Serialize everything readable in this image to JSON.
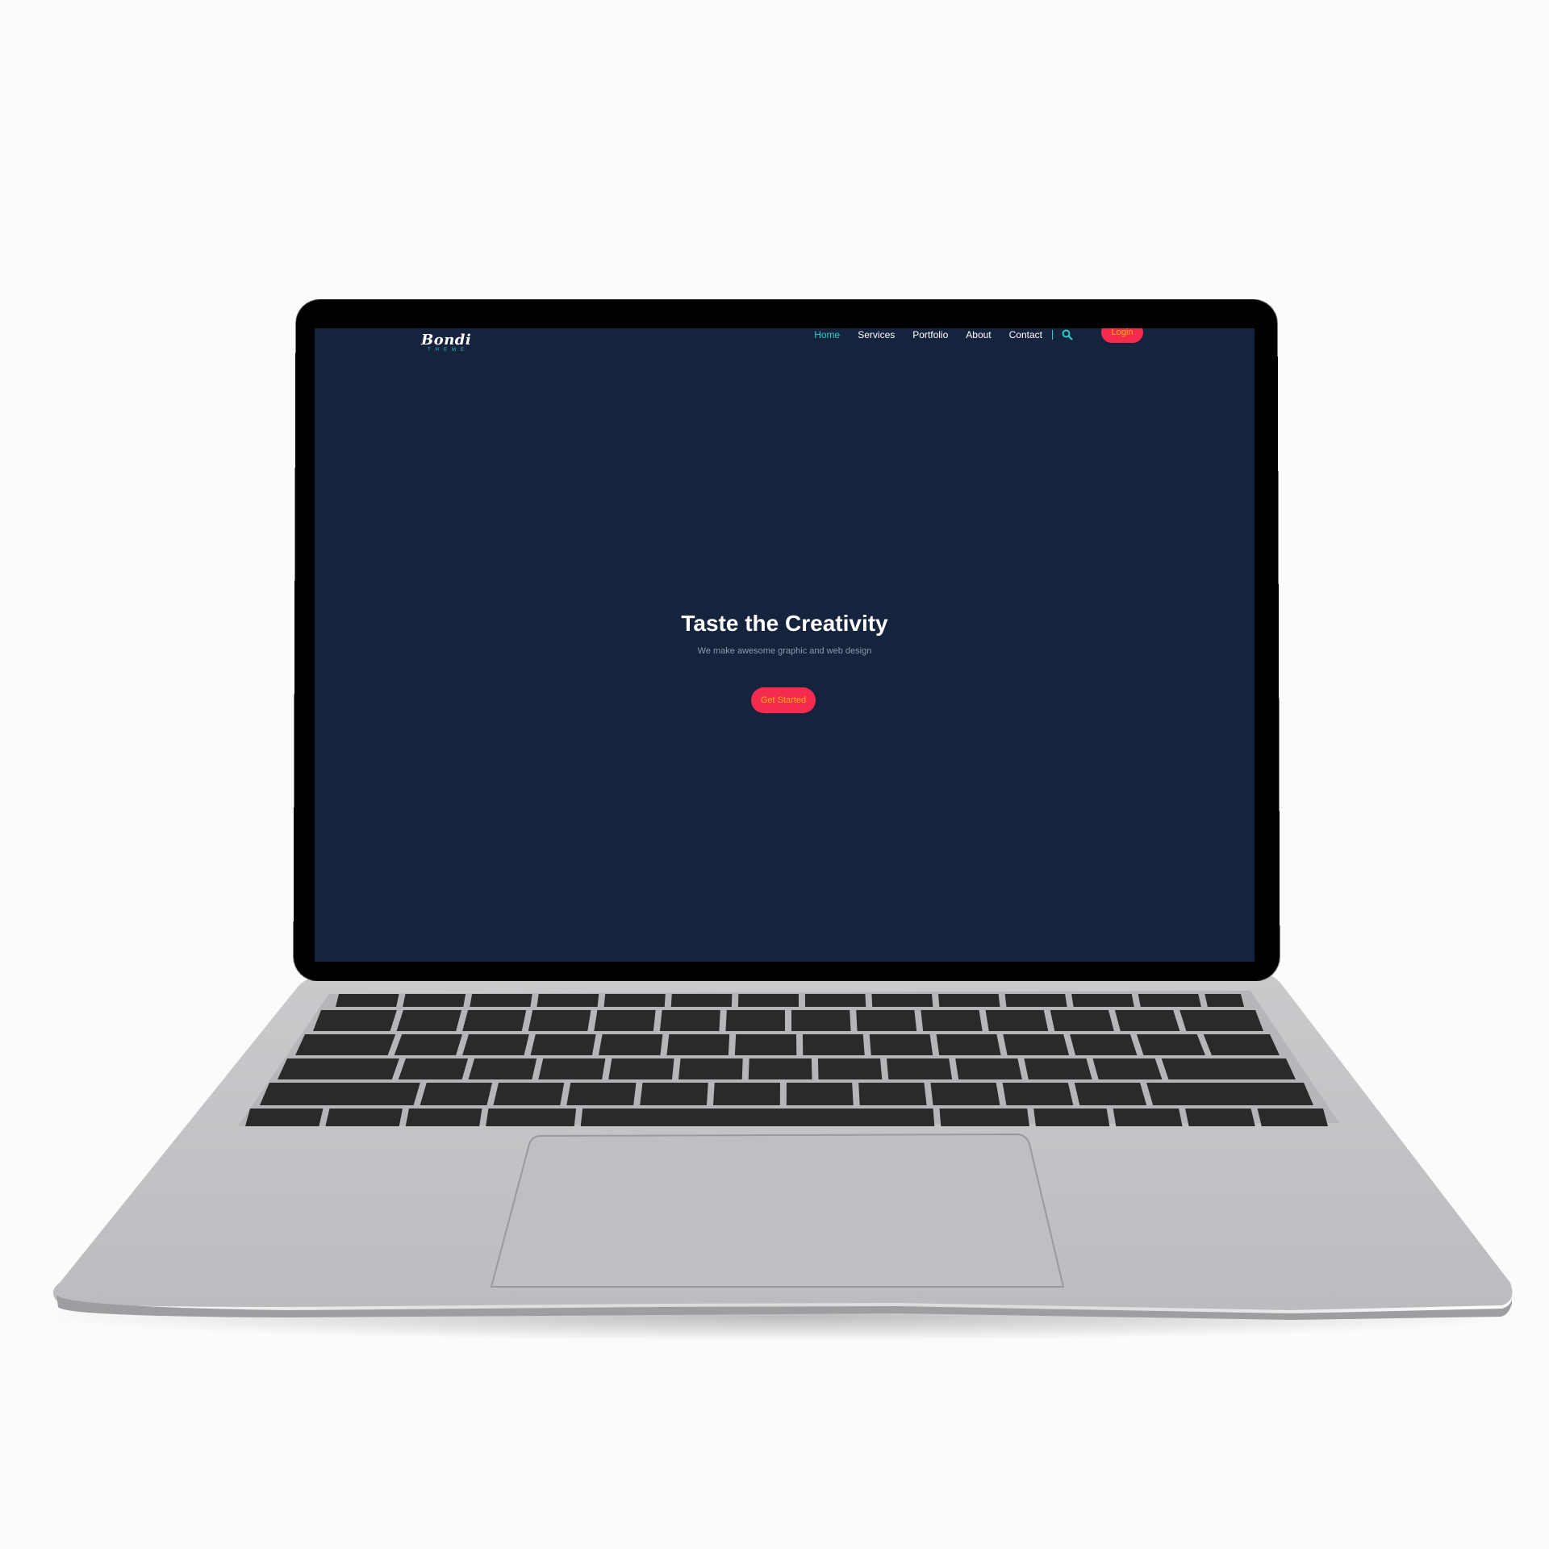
{
  "site": {
    "logo_text": "Bondi",
    "logo_sub": "THEME",
    "nav": {
      "home": "Home",
      "services": "Services",
      "portfolio": "Portfolio",
      "about": "About",
      "contact": "Contact",
      "login": "Login"
    },
    "hero": {
      "title": "Taste the Creativity",
      "subtitle": "We make awesome graphic and web design",
      "cta_label": "Get Started"
    }
  },
  "colors": {
    "screen_background": "#15233d",
    "accent_teal": "#27d0c9",
    "button_red": "#f52a4f",
    "button_text_amber": "#ffb300",
    "laptop_body": "#c0c0c4",
    "keys": "#2a2a2a"
  },
  "icons": [
    "search-icon"
  ]
}
